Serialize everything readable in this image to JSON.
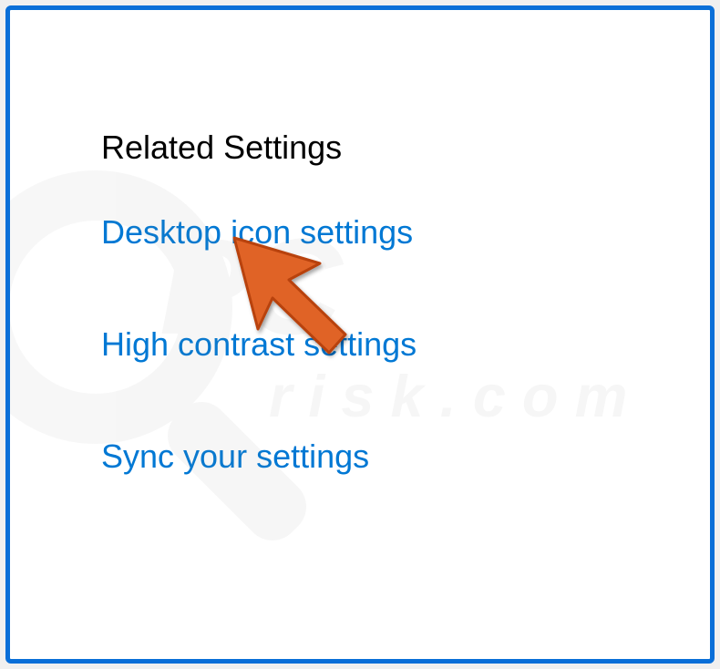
{
  "section": {
    "heading": "Related Settings",
    "links": [
      {
        "label": "Desktop icon settings"
      },
      {
        "label": "High contrast settings"
      },
      {
        "label": "Sync your settings"
      }
    ]
  },
  "colors": {
    "border": "#0a6fd8",
    "link": "#0078d4",
    "cursor": "#e06427"
  },
  "watermark": {
    "text_main": "PC",
    "text_sub": "risk.com"
  }
}
